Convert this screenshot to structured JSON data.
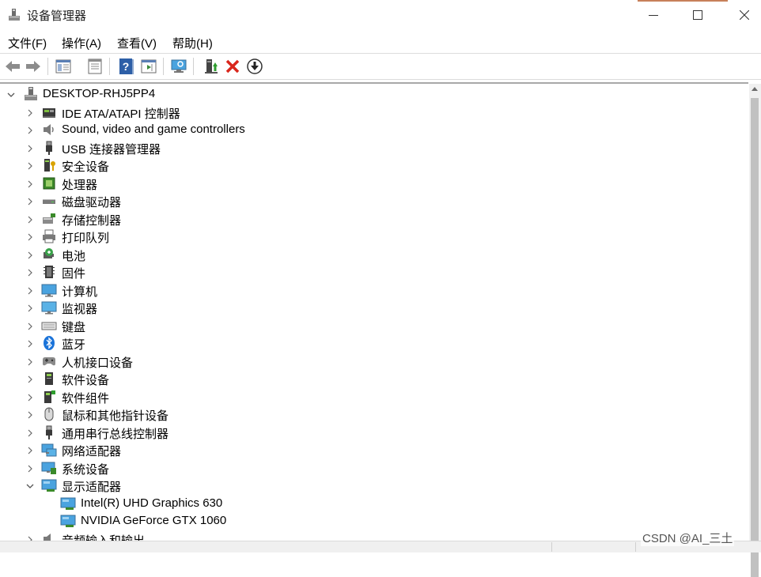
{
  "window": {
    "title": "设备管理器",
    "accent_color": "#c7805a"
  },
  "menu": [
    {
      "label": "文件(F)"
    },
    {
      "label": "操作(A)"
    },
    {
      "label": "查看(V)"
    },
    {
      "label": "帮助(H)"
    }
  ],
  "toolbar": {
    "buttons": [
      {
        "icon": "back-arrow-icon"
      },
      {
        "icon": "forward-arrow-icon"
      },
      {
        "icon": "show-hide-console-tree-icon"
      },
      {
        "icon": "properties-icon"
      },
      {
        "icon": "help-icon"
      },
      {
        "icon": "action-pane-icon"
      },
      {
        "icon": "scan-hardware-changes-icon"
      },
      {
        "icon": "update-driver-icon"
      },
      {
        "icon": "uninstall-device-icon"
      },
      {
        "icon": "download-driver-icon"
      }
    ]
  },
  "tree": {
    "root": {
      "label": "DESKTOP-RHJ5PP4",
      "icon": "computer-tower-icon"
    },
    "categories": [
      {
        "label": "IDE ATA/ATAPI 控制器",
        "icon": "ide-controller-icon"
      },
      {
        "label": "Sound, video and game controllers",
        "icon": "speaker-icon"
      },
      {
        "label": "USB 连接器管理器",
        "icon": "usb-plug-icon"
      },
      {
        "label": "安全设备",
        "icon": "security-key-icon"
      },
      {
        "label": "处理器",
        "icon": "cpu-chip-icon"
      },
      {
        "label": "磁盘驱动器",
        "icon": "disk-drive-icon"
      },
      {
        "label": "存储控制器",
        "icon": "storage-controller-icon"
      },
      {
        "label": "打印队列",
        "icon": "printer-icon"
      },
      {
        "label": "电池",
        "icon": "battery-icon"
      },
      {
        "label": "固件",
        "icon": "firmware-icon"
      },
      {
        "label": "计算机",
        "icon": "computer-monitor-icon"
      },
      {
        "label": "监视器",
        "icon": "monitor-icon"
      },
      {
        "label": "键盘",
        "icon": "keyboard-icon"
      },
      {
        "label": "蓝牙",
        "icon": "bluetooth-icon"
      },
      {
        "label": "人机接口设备",
        "icon": "hid-gamepad-icon"
      },
      {
        "label": "软件设备",
        "icon": "software-device-icon"
      },
      {
        "label": "软件组件",
        "icon": "software-component-icon"
      },
      {
        "label": "鼠标和其他指针设备",
        "icon": "mouse-icon"
      },
      {
        "label": "通用串行总线控制器",
        "icon": "usb-controller-icon"
      },
      {
        "label": "网络适配器",
        "icon": "network-adapter-icon"
      },
      {
        "label": "系统设备",
        "icon": "system-device-icon"
      },
      {
        "label": "显示适配器",
        "icon": "display-adapter-icon",
        "expanded": true,
        "children": [
          {
            "label": "Intel(R) UHD Graphics 630",
            "icon": "display-adapter-icon"
          },
          {
            "label": "NVIDIA GeForce GTX 1060",
            "icon": "display-adapter-icon"
          }
        ]
      },
      {
        "label": "音频输入和输出",
        "icon": "audio-io-icon"
      }
    ]
  },
  "watermark": "CSDN @AI_三土"
}
